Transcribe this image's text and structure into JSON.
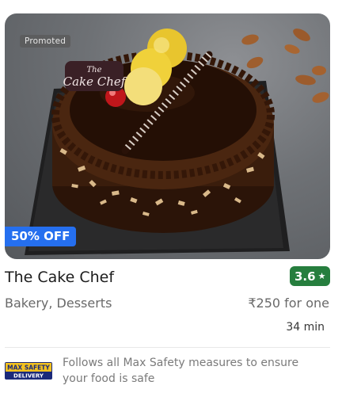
{
  "card": {
    "promoted_label": "Promoted",
    "offer_label": "50% OFF",
    "name": "The Cake Chef",
    "rating": "3.6",
    "rating_color": "#267e3e",
    "cuisines": "Bakery, Desserts",
    "price": "₹250 for one",
    "delivery_time": "34 min",
    "cake_topper_text": "The Cake Chef",
    "safety": {
      "logo_line1": "MAX SAFETY",
      "logo_line2": "DELIVERY",
      "text": "Follows all Max Safety measures to ensure your food is safe"
    },
    "offer_color": "#256fef"
  }
}
